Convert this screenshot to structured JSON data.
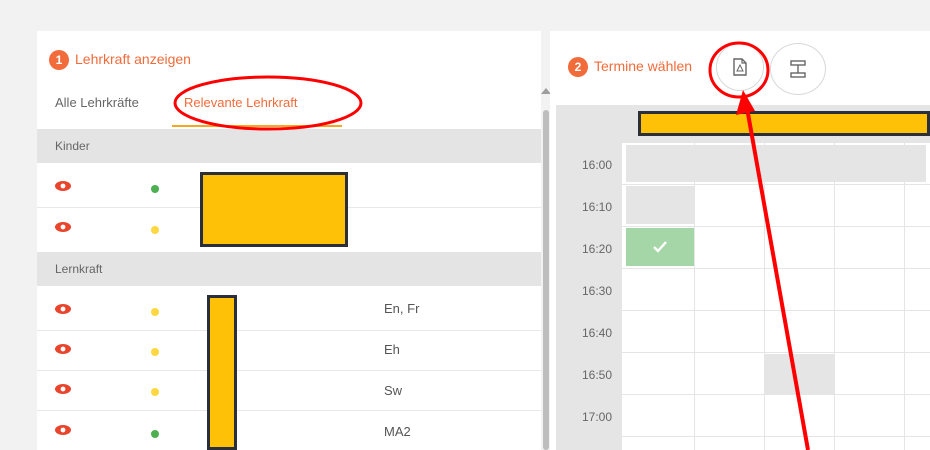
{
  "left_panel": {
    "step_number": "1",
    "title": "Lehrkraft anzeigen",
    "tabs": [
      {
        "label": "Alle Lehrkräfte"
      },
      {
        "label": "Relevante Lehrkraft"
      }
    ],
    "groups": [
      {
        "label": "Kinder"
      },
      {
        "label": "Lernkraft"
      }
    ],
    "rows": [
      {
        "status": "green",
        "subject": ""
      },
      {
        "status": "yellow",
        "subject": ""
      },
      {
        "status": "yellow",
        "subject": "En, Fr"
      },
      {
        "status": "yellow",
        "subject": "Eh"
      },
      {
        "status": "yellow",
        "subject": "Sw"
      },
      {
        "status": "green",
        "subject": "MA2"
      }
    ]
  },
  "right_panel": {
    "step_number": "2",
    "title": "Termine wählen",
    "times": [
      "16:00",
      "16:10",
      "16:20",
      "16:30",
      "16:40",
      "16:50",
      "17:00"
    ],
    "pdf_button_icon": "pdf-icon",
    "layout_button_icon": "layout-icon"
  },
  "colors": {
    "accent": "#f26b3a",
    "tab_underline": "#f5a623",
    "status_green": "#4caf50",
    "status_yellow": "#ffd740",
    "selected_slot": "#a5d6a7",
    "redaction": "#ffc107",
    "annotation_red": "#ff0000"
  }
}
